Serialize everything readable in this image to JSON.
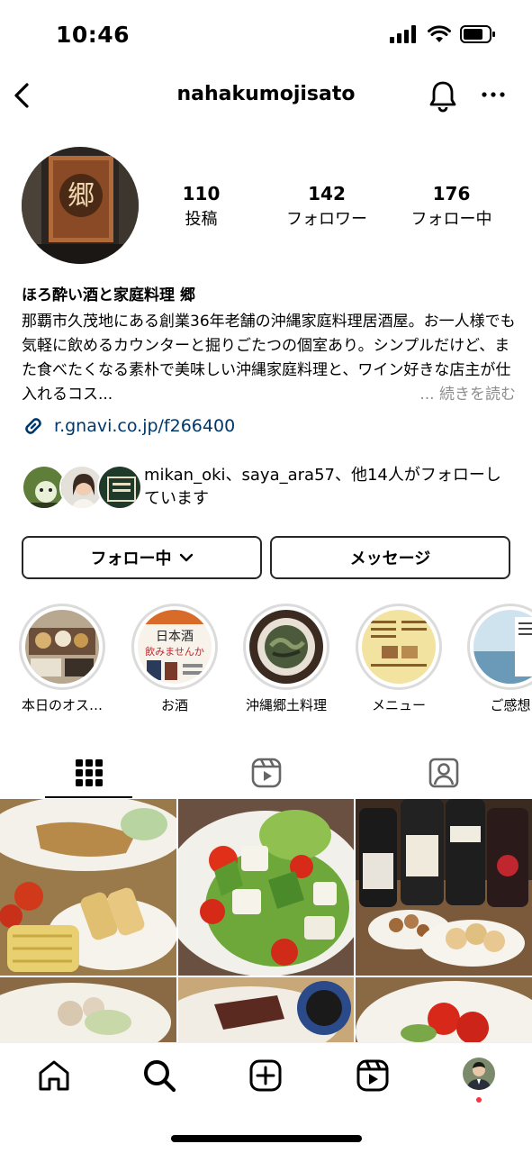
{
  "status_bar": {
    "time": "10:46"
  },
  "header": {
    "username": "nahakumojisato"
  },
  "profile": {
    "avatar_sign": "郷",
    "stats": [
      {
        "value": "110",
        "label": "投稿"
      },
      {
        "value": "142",
        "label": "フォロワー"
      },
      {
        "value": "176",
        "label": "フォロー中"
      }
    ],
    "name": "ほろ酔い酒と家庭料理 郷",
    "bio": "那覇市久茂地にある創業36年老舗の沖縄家庭料理居酒屋。お一人様でも気軽に飲めるカウンターと掘りごたつの個室あり。シンプルだけど、また食べたくなる素朴で美味しい沖縄家庭料理と、ワイン好きな店主が仕入れるコス...",
    "more_label": "... 続きを読む",
    "link": "r.gnavi.co.jp/f266400",
    "followed_by": "mikan_oki、saya_ara57、他14人がフォローしています"
  },
  "actions": {
    "following_label": "フォロー中",
    "message_label": "メッセージ"
  },
  "highlights": [
    {
      "label": "本日のオス…"
    },
    {
      "label": "お酒",
      "img_text_1": "日本酒",
      "img_text_2": "飲みませんか"
    },
    {
      "label": "沖縄郷土料理"
    },
    {
      "label": "メニュー"
    },
    {
      "label": "ご感想"
    }
  ],
  "tabs": [
    "grid-icon",
    "reels-icon",
    "tagged-icon"
  ],
  "bottom_nav": [
    "home-icon",
    "search-icon",
    "create-icon",
    "reels-icon",
    "profile-avatar"
  ],
  "colors": {
    "link": "#00376b",
    "muted": "#8e8e8e",
    "notification_dot": "#ff3040"
  }
}
